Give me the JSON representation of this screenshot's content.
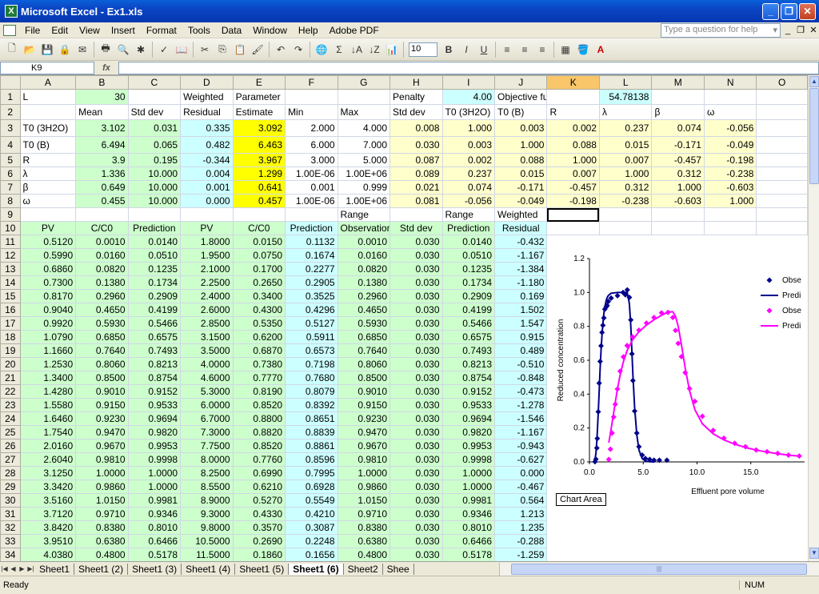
{
  "title": "Microsoft Excel - Ex1.xls",
  "menu": [
    "File",
    "Edit",
    "View",
    "Insert",
    "Format",
    "Tools",
    "Data",
    "Window",
    "Help",
    "Adobe PDF"
  ],
  "help_placeholder": "Type a question for help",
  "font_size": "10",
  "name_box": "K9",
  "fx": "fx",
  "columns": [
    "A",
    "B",
    "C",
    "D",
    "E",
    "F",
    "G",
    "H",
    "I",
    "J",
    "K",
    "L",
    "M",
    "N",
    "O"
  ],
  "rows": [
    [
      "L",
      "30",
      "",
      "Weighted",
      "Parameter",
      "",
      "",
      "Penalty",
      "4.00",
      "Objective function",
      "",
      "54.78138",
      "",
      "",
      ""
    ],
    [
      "",
      "Mean",
      "Std dev",
      "Residual",
      "Estimate",
      "Min",
      "Max",
      "Std dev",
      "T0 (3H2O)",
      "T0 (B)",
      "R",
      "λ",
      "β",
      "ω",
      ""
    ],
    [
      "T0 (3H2O)",
      "3.102",
      "0.031",
      "0.335",
      "3.092",
      "2.000",
      "4.000",
      "0.008",
      "1.000",
      "0.003",
      "0.002",
      "0.237",
      "0.074",
      "-0.056",
      ""
    ],
    [
      "T0 (B)",
      "6.494",
      "0.065",
      "0.482",
      "6.463",
      "6.000",
      "7.000",
      "0.030",
      "0.003",
      "1.000",
      "0.088",
      "0.015",
      "-0.171",
      "-0.049",
      ""
    ],
    [
      "R",
      "3.9",
      "0.195",
      "-0.344",
      "3.967",
      "3.000",
      "5.000",
      "0.087",
      "0.002",
      "0.088",
      "1.000",
      "0.007",
      "-0.457",
      "-0.198",
      ""
    ],
    [
      "λ",
      "1.336",
      "10.000",
      "0.004",
      "1.299",
      "1.00E-06",
      "1.00E+06",
      "0.089",
      "0.237",
      "0.015",
      "0.007",
      "1.000",
      "0.312",
      "-0.238",
      ""
    ],
    [
      "β",
      "0.649",
      "10.000",
      "0.001",
      "0.641",
      "0.001",
      "0.999",
      "0.021",
      "0.074",
      "-0.171",
      "-0.457",
      "0.312",
      "1.000",
      "-0.603",
      ""
    ],
    [
      "ω",
      "0.455",
      "10.000",
      "0.000",
      "0.457",
      "1.00E-06",
      "1.00E+06",
      "0.081",
      "-0.056",
      "-0.049",
      "-0.198",
      "-0.238",
      "-0.603",
      "1.000",
      ""
    ],
    [
      "",
      "",
      "",
      "",
      "",
      "",
      "Range",
      "",
      "Range",
      "Weighted",
      "",
      "",
      "",
      "",
      ""
    ],
    [
      "PV",
      "C/C0",
      "Prediction",
      "PV",
      "C/C0",
      "Prediction",
      "Observation",
      "Std dev",
      "Prediction",
      "Residual",
      "",
      "",
      "",
      "",
      ""
    ],
    [
      "0.5120",
      "0.0010",
      "0.0140",
      "1.8000",
      "0.0150",
      "0.1132",
      "0.0010",
      "0.030",
      "0.0140",
      "-0.432",
      "",
      "",
      "",
      "",
      ""
    ],
    [
      "0.5990",
      "0.0160",
      "0.0510",
      "1.9500",
      "0.0750",
      "0.1674",
      "0.0160",
      "0.030",
      "0.0510",
      "-1.167",
      "",
      "",
      "",
      "",
      ""
    ],
    [
      "0.6860",
      "0.0820",
      "0.1235",
      "2.1000",
      "0.1700",
      "0.2277",
      "0.0820",
      "0.030",
      "0.1235",
      "-1.384",
      "",
      "",
      "",
      "",
      ""
    ],
    [
      "0.7300",
      "0.1380",
      "0.1734",
      "2.2500",
      "0.2650",
      "0.2905",
      "0.1380",
      "0.030",
      "0.1734",
      "-1.180",
      "",
      "",
      "",
      "",
      ""
    ],
    [
      "0.8170",
      "0.2960",
      "0.2909",
      "2.4000",
      "0.3400",
      "0.3525",
      "0.2960",
      "0.030",
      "0.2909",
      "0.169",
      "",
      "",
      "",
      "",
      ""
    ],
    [
      "0.9040",
      "0.4650",
      "0.4199",
      "2.6000",
      "0.4300",
      "0.4296",
      "0.4650",
      "0.030",
      "0.4199",
      "1.502",
      "",
      "",
      "",
      "",
      ""
    ],
    [
      "0.9920",
      "0.5930",
      "0.5466",
      "2.8500",
      "0.5350",
      "0.5127",
      "0.5930",
      "0.030",
      "0.5466",
      "1.547",
      "",
      "",
      "",
      "",
      ""
    ],
    [
      "1.0790",
      "0.6850",
      "0.6575",
      "3.1500",
      "0.6200",
      "0.5911",
      "0.6850",
      "0.030",
      "0.6575",
      "0.915",
      "",
      "",
      "",
      "",
      ""
    ],
    [
      "1.1660",
      "0.7640",
      "0.7493",
      "3.5000",
      "0.6870",
      "0.6573",
      "0.7640",
      "0.030",
      "0.7493",
      "0.489",
      "",
      "",
      "",
      "",
      ""
    ],
    [
      "1.2530",
      "0.8060",
      "0.8213",
      "4.0000",
      "0.7380",
      "0.7198",
      "0.8060",
      "0.030",
      "0.8213",
      "-0.510",
      "",
      "",
      "",
      "",
      ""
    ],
    [
      "1.3400",
      "0.8500",
      "0.8754",
      "4.6000",
      "0.7770",
      "0.7680",
      "0.8500",
      "0.030",
      "0.8754",
      "-0.848",
      "",
      "",
      "",
      "",
      ""
    ],
    [
      "1.4280",
      "0.9010",
      "0.9152",
      "5.3000",
      "0.8190",
      "0.8079",
      "0.9010",
      "0.030",
      "0.9152",
      "-0.473",
      "",
      "",
      "",
      "",
      ""
    ],
    [
      "1.5580",
      "0.9150",
      "0.9533",
      "6.0000",
      "0.8520",
      "0.8392",
      "0.9150",
      "0.030",
      "0.9533",
      "-1.278",
      "",
      "",
      "",
      "",
      ""
    ],
    [
      "1.6460",
      "0.9230",
      "0.9694",
      "6.7000",
      "0.8800",
      "0.8651",
      "0.9230",
      "0.030",
      "0.9694",
      "-1.546",
      "",
      "",
      "",
      "",
      ""
    ],
    [
      "1.7540",
      "0.9470",
      "0.9820",
      "7.3000",
      "0.8820",
      "0.8839",
      "0.9470",
      "0.030",
      "0.9820",
      "-1.167",
      "",
      "",
      "",
      "",
      ""
    ],
    [
      "2.0160",
      "0.9670",
      "0.9953",
      "7.7500",
      "0.8520",
      "0.8861",
      "0.9670",
      "0.030",
      "0.9953",
      "-0.943",
      "",
      "",
      "",
      "",
      ""
    ],
    [
      "2.6040",
      "0.9810",
      "0.9998",
      "8.0000",
      "0.7760",
      "0.8596",
      "0.9810",
      "0.030",
      "0.9998",
      "-0.627",
      "",
      "",
      "",
      "",
      ""
    ],
    [
      "3.1250",
      "1.0000",
      "1.0000",
      "8.2500",
      "0.6990",
      "0.7995",
      "1.0000",
      "0.030",
      "1.0000",
      "0.000",
      "",
      "",
      "",
      "",
      ""
    ],
    [
      "3.3420",
      "0.9860",
      "1.0000",
      "8.5500",
      "0.6210",
      "0.6928",
      "0.9860",
      "0.030",
      "1.0000",
      "-0.467",
      "",
      "",
      "",
      "",
      ""
    ],
    [
      "3.5160",
      "1.0150",
      "0.9981",
      "8.9000",
      "0.5270",
      "0.5549",
      "1.0150",
      "0.030",
      "0.9981",
      "0.564",
      "",
      "",
      "",
      "",
      ""
    ],
    [
      "3.7120",
      "0.9710",
      "0.9346",
      "9.3000",
      "0.4330",
      "0.4210",
      "0.9710",
      "0.030",
      "0.9346",
      "1.213",
      "",
      "",
      "",
      "",
      ""
    ],
    [
      "3.8420",
      "0.8380",
      "0.8010",
      "9.8000",
      "0.3570",
      "0.3087",
      "0.8380",
      "0.030",
      "0.8010",
      "1.235",
      "",
      "",
      "",
      "",
      ""
    ],
    [
      "3.9510",
      "0.6380",
      "0.6466",
      "10.5000",
      "0.2690",
      "0.2248",
      "0.6380",
      "0.030",
      "0.6466",
      "-0.288",
      "",
      "",
      "",
      "",
      ""
    ],
    [
      "4.0380",
      "0.4800",
      "0.5178",
      "11.5000",
      "0.1860",
      "0.1656",
      "0.4800",
      "0.030",
      "0.5178",
      "-1.259",
      "",
      "",
      "",
      "",
      ""
    ]
  ],
  "sheet_tabs": [
    "Sheet1",
    "Sheet1 (2)",
    "Sheet1 (3)",
    "Sheet1 (4)",
    "Sheet1 (5)",
    "Sheet1 (6)",
    "Sheet2",
    "Shee"
  ],
  "active_tab": "Sheet1 (6)",
  "status": "Ready",
  "num": "NUM",
  "chart_label": "Chart Area",
  "colors": {
    "green": "#ccffcc",
    "yellow": "#ffff99",
    "paleyellow": "#ffffcc",
    "cyan": "#ccffff",
    "bright": "#ffff00",
    "blue": "#00008b",
    "magenta": "#ff00ff"
  },
  "chart_data": {
    "type": "scatter",
    "xlabel": "Effluent pore volume",
    "ylabel": "Reduced concentration",
    "xlim": [
      0,
      20
    ],
    "ylim": [
      0,
      1.2
    ],
    "xticks": [
      "0.0",
      "5.0",
      "10.0",
      "15.0"
    ],
    "yticks": [
      "0.0",
      "0.2",
      "0.4",
      "0.6",
      "0.8",
      "1.0",
      "1.2"
    ],
    "legend": [
      "Obse",
      "Predi",
      "Obse",
      "Predi"
    ],
    "legend_placement": "right",
    "series": [
      {
        "name": "Obse",
        "kind": "points",
        "color": "#00008b",
        "x": [
          0.512,
          0.599,
          0.686,
          0.73,
          0.817,
          0.904,
          0.992,
          1.079,
          1.166,
          1.253,
          1.34,
          1.428,
          1.558,
          1.646,
          1.754,
          2.016,
          2.604,
          3.125,
          3.342,
          3.516,
          3.712,
          3.842,
          3.951,
          4.038,
          4.2,
          4.4,
          4.6,
          4.9,
          5.2,
          5.6,
          6.0,
          6.5,
          7.2
        ],
        "y": [
          0.001,
          0.016,
          0.082,
          0.138,
          0.296,
          0.465,
          0.593,
          0.685,
          0.764,
          0.806,
          0.85,
          0.901,
          0.915,
          0.923,
          0.947,
          0.967,
          0.981,
          1.0,
          0.986,
          1.015,
          0.971,
          0.838,
          0.638,
          0.48,
          0.3,
          0.17,
          0.09,
          0.04,
          0.02,
          0.015,
          0.01,
          0.01,
          0.01
        ]
      },
      {
        "name": "Predi",
        "kind": "line",
        "color": "#00008b",
        "x": [
          0.512,
          0.599,
          0.686,
          0.73,
          0.817,
          0.904,
          0.992,
          1.079,
          1.166,
          1.253,
          1.34,
          1.428,
          1.558,
          1.646,
          1.754,
          2.016,
          2.604,
          3.125,
          3.342,
          3.516,
          3.712,
          3.842,
          3.951,
          4.038,
          4.2,
          4.4,
          4.6,
          4.9,
          5.2,
          5.6,
          6.0
        ],
        "y": [
          0.014,
          0.051,
          0.1235,
          0.1734,
          0.2909,
          0.4199,
          0.5466,
          0.6575,
          0.7493,
          0.8213,
          0.8754,
          0.9152,
          0.9533,
          0.9694,
          0.982,
          0.9953,
          0.9998,
          1.0,
          1.0,
          0.9981,
          0.9346,
          0.801,
          0.6466,
          0.5178,
          0.32,
          0.16,
          0.07,
          0.02,
          0.005,
          0.001,
          0.0
        ]
      },
      {
        "name": "Obse",
        "kind": "points",
        "color": "#ff00ff",
        "x": [
          1.8,
          1.95,
          2.1,
          2.25,
          2.4,
          2.6,
          2.85,
          3.15,
          3.5,
          4.0,
          4.6,
          5.3,
          6.0,
          6.7,
          7.3,
          7.75,
          8.0,
          8.25,
          8.55,
          8.9,
          9.3,
          9.8,
          10.5,
          11.5,
          12.5,
          13.5,
          14.5,
          15.5,
          16.5,
          17.5,
          18.5,
          19.5
        ],
        "y": [
          0.015,
          0.075,
          0.17,
          0.265,
          0.34,
          0.43,
          0.535,
          0.62,
          0.687,
          0.738,
          0.777,
          0.819,
          0.852,
          0.88,
          0.882,
          0.852,
          0.776,
          0.699,
          0.621,
          0.527,
          0.433,
          0.357,
          0.269,
          0.186,
          0.14,
          0.11,
          0.09,
          0.07,
          0.06,
          0.05,
          0.04,
          0.035
        ]
      },
      {
        "name": "Predi",
        "kind": "line",
        "color": "#ff00ff",
        "x": [
          1.8,
          1.95,
          2.1,
          2.25,
          2.4,
          2.6,
          2.85,
          3.15,
          3.5,
          4.0,
          4.6,
          5.3,
          6.0,
          6.7,
          7.3,
          7.75,
          8.0,
          8.25,
          8.55,
          8.9,
          9.3,
          9.8,
          10.5,
          11.5,
          12.5,
          13.5,
          14.5,
          15.5,
          16.5,
          17.5,
          18.5,
          19.5
        ],
        "y": [
          0.1132,
          0.1674,
          0.2277,
          0.2905,
          0.3525,
          0.4296,
          0.5127,
          0.5911,
          0.6573,
          0.7198,
          0.768,
          0.8079,
          0.8392,
          0.8651,
          0.8839,
          0.8861,
          0.8596,
          0.7995,
          0.6928,
          0.5549,
          0.421,
          0.3087,
          0.2248,
          0.1656,
          0.13,
          0.105,
          0.085,
          0.07,
          0.058,
          0.048,
          0.04,
          0.034
        ]
      }
    ]
  }
}
